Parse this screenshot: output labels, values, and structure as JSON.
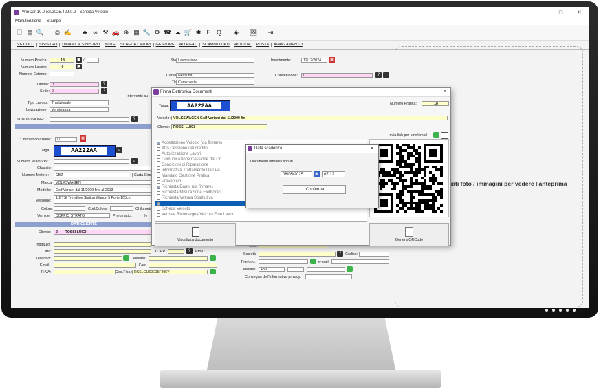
{
  "window": {
    "title": "WinCar 10.0 rel.2025.429.0.2 - Scheda Veicolo",
    "minimize": "–",
    "maximize": "▢",
    "close": "✕"
  },
  "menu": [
    "Manutenzione",
    "Stampe"
  ],
  "toolbar_icons": [
    "new-doc-icon",
    "edit-doc-icon",
    "search-doc-icon",
    "print-icon",
    "signature-icon",
    "tree-icon",
    "binoculars-icon",
    "tools-icon",
    "car-icon",
    "lifebuoy-icon",
    "sheet-icon",
    "wrench-icon",
    "settings-icon",
    "phone-icon",
    "cloud-icon",
    "cart-icon",
    "gear-icon",
    "excel-icon",
    "q-icon",
    "disk-icon",
    "picture-icon",
    "exit-icon"
  ],
  "tabs": [
    "VEICOLO",
    "SINISTRO",
    "DINAMICA SINISTRO",
    "NOTE",
    "SCHEDA LAVORI",
    "GESTORE",
    "ALLEGATI",
    "SCAMBIO DATI",
    "ATTIVITA'",
    "POSTA",
    "AVANZAMENTO"
  ],
  "form": {
    "numero_pratica_label": "Numero Pratica:",
    "numero_pratica": "18",
    "numero_pratica_sep": "/",
    "numero_lavoro_label": "Numero Lavoro:",
    "numero_lavoro": "0",
    "numero_esterno_label": "Numero Esterno:",
    "utente_label": "Utente:",
    "utente": "0",
    "sede_label": "Sede:",
    "sede": "0",
    "tipo_lavoro_label": "Tipo Lavoro:",
    "tipo_lavoro": "Tradizionale",
    "lavorazione_label": "Lavorazione:",
    "lavorazione": "Verniciatura",
    "suddivisione_label": "SUDDIVISIONE:",
    "stato_pratica_label": "Stato pratica:",
    "stato_pratica": "Lavorazione",
    "canalizzazione_label": "Canalizzazione:",
    "canalizzazione": "Nessuna",
    "tipo_pratica_label": "Tipo pratica:",
    "tipo_pratica": "Carrozzeria",
    "intervento_label": "Intervento su",
    "inserimento_label": "Inserimento:",
    "inserimento": "12/12/2024",
    "convenzione_label": "Convenzione:",
    "convenzione": "0",
    "immatricolazione_label": "1° immatricolazione:",
    "immatricolazione": "/ /",
    "targa_label": "Targa:",
    "targa": "AA222AA",
    "telaio_label": "Numero Telaio VIN:",
    "chassis_label": "Chassis:",
    "motore_label": "Numero Motore:",
    "motore": "CBZ",
    "carta_circ_label": "| Carta Circ",
    "marca_label": "Marca:",
    "marca": "VOLKSWAGEN",
    "modello_label": "Modello:",
    "modello": "Golf Variant dal 11/2009 fino al 2013",
    "versione_label": "Versione:",
    "versione": "1.2 TSI Trendline Station Wagon 5 Porte 105cv.",
    "colore_label": "Colore:",
    "cod_colore_label": "Cod.Colore:",
    "chilometri_label": "Chilometri",
    "vernice_label": "Vernice:",
    "vernice": "DOPPIO STRATO",
    "pneumatici_label": "Pneumatici:",
    "pct": "%",
    "dati_cliente": "DATI CLIENTE",
    "cliente_label": "Cliente:",
    "cliente_num": "2",
    "cliente": "ROSSI LUIGI",
    "indirizzo_label": "Indirizzo:",
    "citta_label": "Città:",
    "cap_label": "C.A.P.:",
    "prov_label": "Prov.:",
    "telefono_label": "Telefono:",
    "cellulare_label": "Cellulare:",
    "email_label": "Email:",
    "fax_label": "Fax:",
    "piva_label": "P.IVA:",
    "cod_fisc_label": "Cod.Fisc.:",
    "cod_fisc": "RSSLGU69E15F205Y",
    "citta2_label": "Città:",
    "societa_label": "Società:",
    "codice_label": "Codice:",
    "telefono2_label": "Telefono:",
    "email2_label": "e-mail:",
    "cellulare2_label": "Cellulare:",
    "prefisso": "+39",
    "consegna_label": "Consegna dell'informativa privacy:"
  },
  "photo_hint": "gati foto / immagini per vedere l'anteprima",
  "dialog": {
    "title": "Firma Elettronica Documenti",
    "targa_label": "Targa:",
    "targa": "AA222AA",
    "numero_pratica_label": "Numero Pratica:",
    "numero_pratica": "18",
    "veicolo_label": "Veicolo:",
    "veicolo": "VOLKSWAGEN  Golf Variant dal 11/2009 fin",
    "cliente_label": "Cliente:",
    "cliente": "ROSSI LUIGI",
    "invia_label": "Invia link per sms/email",
    "documents": [
      {
        "label": "Accettazione Veicolo  (da firmare)",
        "checked": true
      },
      {
        "label": "Atto Cessione del credito",
        "checked": false
      },
      {
        "label": "Autorizzazione Lavori",
        "checked": false
      },
      {
        "label": "Comunicazione Cessione del Cr",
        "checked": false
      },
      {
        "label": "Condizioni di Riparazione",
        "checked": false
      },
      {
        "label": "Informativa Trattamento Dati Pe",
        "checked": false
      },
      {
        "label": "Mandato Gestione Pratica",
        "checked": false
      },
      {
        "label": "Preventivo",
        "checked": false
      },
      {
        "label": "Richiesta Danni  (da firmare)",
        "checked": true
      },
      {
        "label": "Richiesta Misurazione Elettronici",
        "checked": false
      },
      {
        "label": "Richiesta Vettura Sostitutiva",
        "checked": false
      },
      {
        "label": "",
        "checked": true
      },
      {
        "label": "Scheda Veicolo",
        "checked": false
      },
      {
        "label": "Verbale Riconsegna Veicolo Fine Lavori",
        "checked": false
      }
    ],
    "visualizza_label": "Visualizza documento",
    "genera_qr_label": "Genera QRCode"
  },
  "subdialog": {
    "title": "Data scadenza",
    "label": "Documenti firmabili fino al",
    "date": "08/05/2025",
    "time": "07:12",
    "confirm": "Conferma"
  }
}
